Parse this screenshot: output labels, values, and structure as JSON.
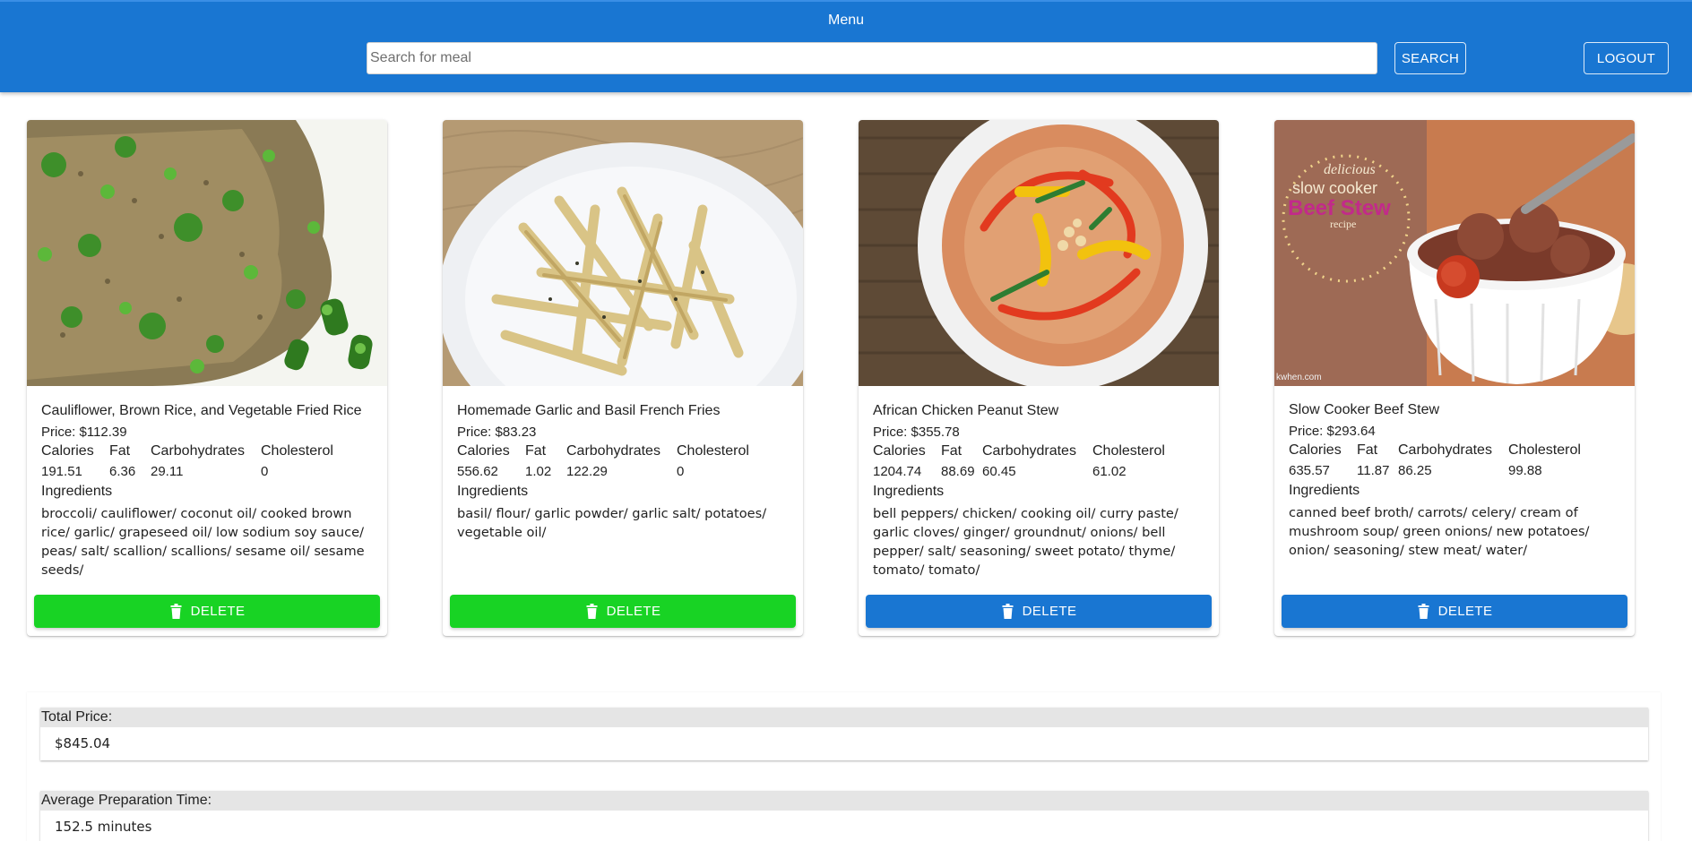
{
  "header": {
    "title": "Menu",
    "search_placeholder": "Search for meal",
    "search_label": "SEARCH",
    "logout_label": "LOGOUT",
    "color": "#1976d2"
  },
  "nutrition_headers": [
    "Calories",
    "Fat",
    "Carbohydrates",
    "Cholesterol"
  ],
  "ingredients_label": "Ingredients",
  "meals": [
    {
      "name": "Cauliflower, Brown Rice, and Vegetable Fried Rice",
      "price": "Price: $112.39",
      "calories": "191.51",
      "fat": "6.36",
      "carbohydrates": "29.11",
      "cholesterol": "0",
      "ingredients": "broccoli/ cauliflower/ coconut oil/ cooked brown rice/ garlic/ grapeseed oil/ low sodium soy sauce/ peas/ salt/ scallion/ scallions/ sesame oil/ sesame seeds/",
      "delete_label": "DELETE",
      "button_color": "#18d324",
      "image_icon": "fried-rice-photo"
    },
    {
      "name": "Homemade Garlic and Basil French Fries",
      "price": "Price: $83.23",
      "calories": "556.62",
      "fat": "1.02",
      "carbohydrates": "122.29",
      "cholesterol": "0",
      "ingredients": "basil/ flour/ garlic powder/ garlic salt/ potatoes/ vegetable oil/",
      "delete_label": "DELETE",
      "button_color": "#18d324",
      "image_icon": "french-fries-photo"
    },
    {
      "name": "African Chicken Peanut Stew",
      "price": "Price: $355.78",
      "calories": "1204.74",
      "fat": "88.69",
      "carbohydrates": "60.45",
      "cholesterol": "61.02",
      "ingredients": "bell peppers/ chicken/ cooking oil/ curry paste/ garlic cloves/ ginger/ groundnut/ onions/ bell pepper/ salt/ seasoning/ sweet potato/ thyme/ tomato/ tomato/",
      "delete_label": "DELETE",
      "button_color": "#1976d2",
      "image_icon": "peanut-stew-photo"
    },
    {
      "name": "Slow Cooker Beef Stew",
      "price": "Price: $293.64",
      "calories": "635.57",
      "fat": "11.87",
      "carbohydrates": "86.25",
      "cholesterol": "99.88",
      "ingredients": "canned beef broth/ carrots/ celery/ cream of mushroom soup/ green onions/ new potatoes/ onion/ seasoning/ stew meat/ water/",
      "delete_label": "DELETE",
      "button_color": "#1976d2",
      "image_icon": "beef-stew-photo",
      "image_text": {
        "line1": "delicious",
        "line2": "slow cooker",
        "line3": "Beef Stew",
        "line4": "recipe",
        "watermark": "kwhen.com"
      }
    }
  ],
  "summary": {
    "total_price_label": "Total Price:",
    "total_price_value": "$845.04",
    "avg_prep_label": "Average Preparation Time:",
    "avg_prep_value": "152.5 minutes"
  }
}
